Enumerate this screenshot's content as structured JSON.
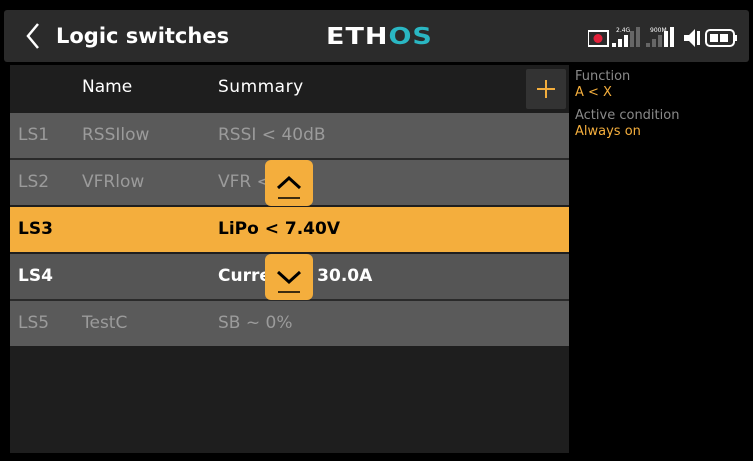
{
  "header": {
    "back_icon": "chevron-left-icon",
    "title": "Logic switches",
    "logo_part1": "ETH",
    "logo_part2": "OS",
    "logo_accent_color": "#2ab7c3",
    "status": {
      "rx_label_24": "2.4G",
      "rx_label_900": "900M",
      "icons": [
        "record-icon",
        "signal-2.4g-icon",
        "signal-900m-icon",
        "speaker-icon",
        "battery-icon"
      ]
    }
  },
  "table": {
    "col_name": "Name",
    "col_summary": "Summary",
    "add_label": "+",
    "rows": [
      {
        "id": "LS1",
        "name": "RSSIlow",
        "summary": "RSSI < 40dB",
        "state": "dim"
      },
      {
        "id": "LS2",
        "name": "VFRlow",
        "summary": "VFR < 50%",
        "state": "dim"
      },
      {
        "id": "LS3",
        "name": "",
        "summary": "LiPo < 7.40V",
        "state": "selected"
      },
      {
        "id": "LS4",
        "name": "",
        "summary": "Current > 30.0A",
        "state": "active"
      },
      {
        "id": "LS5",
        "name": "TestC",
        "summary": "SB ~ 0%",
        "state": "dim"
      }
    ]
  },
  "details": {
    "function_label": "Function",
    "function_value": "A < X",
    "active_label": "Active condition",
    "active_value": "Always on"
  },
  "colors": {
    "accent": "#f4ae3d",
    "dim_row": "#5a5a5a",
    "active_row": "#555555"
  }
}
